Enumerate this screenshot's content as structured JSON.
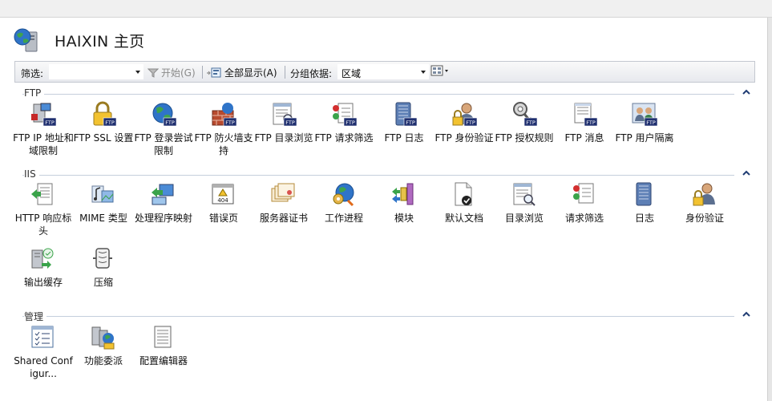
{
  "header": {
    "title": "HAIXIN 主页"
  },
  "toolbar": {
    "filter_label": "筛选:",
    "filter_value": "",
    "go_label": "开始(G)",
    "show_all_label": "全部显示(A)",
    "group_by_label": "分组依据:",
    "group_by_value": "区域"
  },
  "groups": [
    {
      "title": "FTP",
      "items": [
        {
          "label": "FTP IP 地址和域限制",
          "icon": "ftp-ip-restrictions-icon"
        },
        {
          "label": "FTP SSL 设置",
          "icon": "ftp-ssl-lock-icon"
        },
        {
          "label": "FTP 登录尝试限制",
          "icon": "ftp-logon-attempts-globe-icon"
        },
        {
          "label": "FTP 防火墙支持",
          "icon": "ftp-firewall-icon"
        },
        {
          "label": "FTP 目录浏览",
          "icon": "ftp-directory-browse-icon"
        },
        {
          "label": "FTP 请求筛选",
          "icon": "ftp-request-filter-icon"
        },
        {
          "label": "FTP 日志",
          "icon": "ftp-logging-icon"
        },
        {
          "label": "FTP 身份验证",
          "icon": "ftp-authentication-icon"
        },
        {
          "label": "FTP 授权规则",
          "icon": "ftp-authorization-key-icon"
        },
        {
          "label": "FTP 消息",
          "icon": "ftp-messages-icon"
        },
        {
          "label": "FTP 用户隔离",
          "icon": "ftp-user-isolation-icon"
        }
      ]
    },
    {
      "title": "IIS",
      "items": [
        {
          "label": "HTTP 响应标头",
          "icon": "http-response-headers-icon"
        },
        {
          "label": "MIME 类型",
          "icon": "mime-types-icon"
        },
        {
          "label": "处理程序映射",
          "icon": "handler-mappings-icon"
        },
        {
          "label": "错误页",
          "icon": "error-pages-404-icon"
        },
        {
          "label": "服务器证书",
          "icon": "server-certificates-icon"
        },
        {
          "label": "工作进程",
          "icon": "worker-processes-icon"
        },
        {
          "label": "模块",
          "icon": "modules-icon"
        },
        {
          "label": "默认文档",
          "icon": "default-document-icon"
        },
        {
          "label": "目录浏览",
          "icon": "directory-browsing-icon"
        },
        {
          "label": "请求筛选",
          "icon": "request-filtering-icon"
        },
        {
          "label": "日志",
          "icon": "logging-icon"
        },
        {
          "label": "身份验证",
          "icon": "authentication-icon"
        },
        {
          "label": "输出缓存",
          "icon": "output-caching-icon"
        },
        {
          "label": "压缩",
          "icon": "compression-icon"
        }
      ]
    },
    {
      "title": "管理",
      "items": [
        {
          "label": "Shared Configur...",
          "icon": "shared-configuration-icon"
        },
        {
          "label": "功能委派",
          "icon": "feature-delegation-icon"
        },
        {
          "label": "配置编辑器",
          "icon": "configuration-editor-icon"
        }
      ]
    }
  ],
  "colors": {
    "ftp_badge": "#1f2f6f",
    "group_line": "#c5cfdc",
    "globe_blue": "#2f74c8",
    "globe_green": "#3fa34d"
  }
}
